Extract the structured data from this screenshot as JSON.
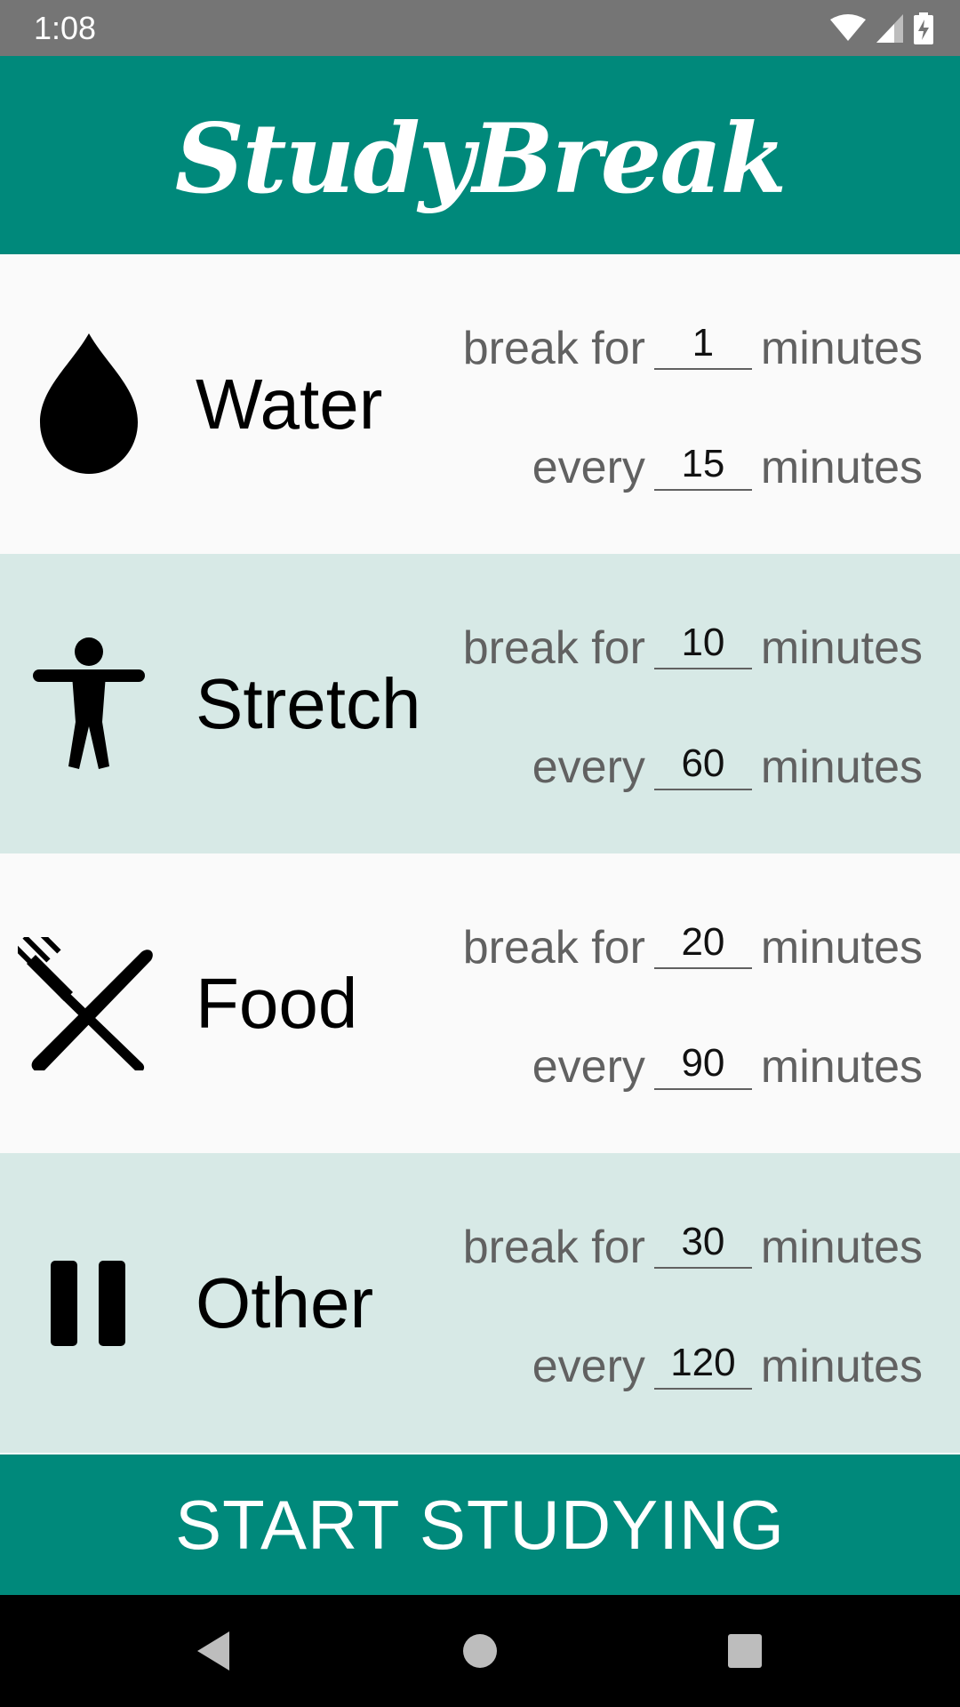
{
  "status_bar": {
    "time": "1:08"
  },
  "header": {
    "title": "StudyBreak"
  },
  "rows": [
    {
      "name": "Water",
      "icon": "water-drop-icon",
      "break_label": "break for",
      "break_value": "1",
      "break_unit": "minutes",
      "every_label": "every",
      "every_value": "15",
      "every_unit": "minutes"
    },
    {
      "name": "Stretch",
      "icon": "person-stretch-icon",
      "break_label": "break for",
      "break_value": "10",
      "break_unit": "minutes",
      "every_label": "every",
      "every_value": "60",
      "every_unit": "minutes"
    },
    {
      "name": "Food",
      "icon": "fork-knife-icon",
      "break_label": "break for",
      "break_value": "20",
      "break_unit": "minutes",
      "every_label": "every",
      "every_value": "90",
      "every_unit": "minutes"
    },
    {
      "name": "Other",
      "icon": "pause-icon",
      "break_label": "break for",
      "break_value": "30",
      "break_unit": "minutes",
      "every_label": "every",
      "every_value": "120",
      "every_unit": "minutes"
    }
  ],
  "start_button": {
    "label": "START STUDYING"
  },
  "colors": {
    "accent": "#00897b",
    "row_tint": "#d7e9e6",
    "row_light": "#fafafa",
    "status_bar": "#757575"
  }
}
